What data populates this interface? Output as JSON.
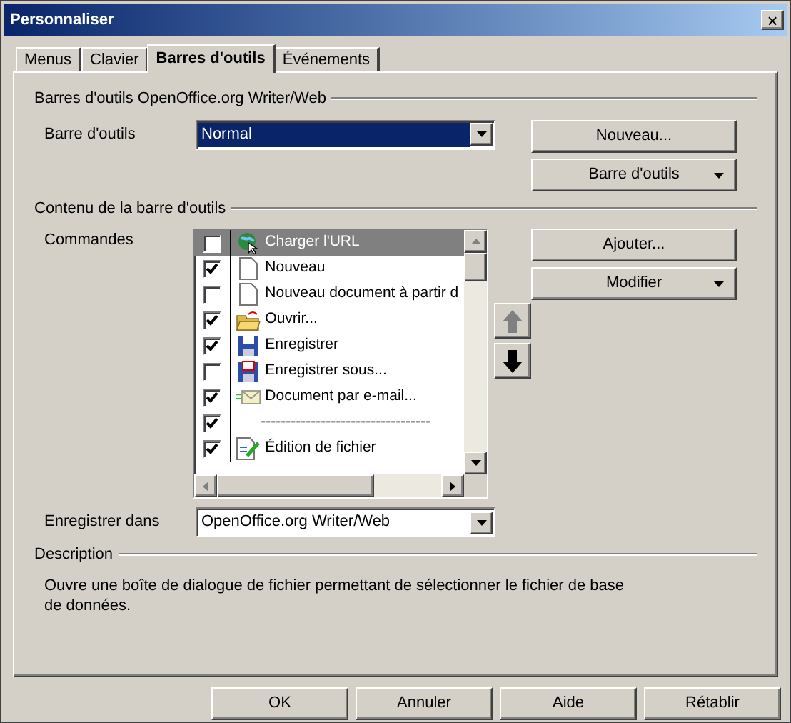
{
  "window": {
    "title": "Personnaliser",
    "close": "×"
  },
  "tabs": [
    {
      "label": "Menus",
      "selected": false
    },
    {
      "label": "Clavier",
      "selected": false
    },
    {
      "label": "Barres d'outils",
      "selected": true
    },
    {
      "label": "Événements",
      "selected": false
    }
  ],
  "toolbars_group": {
    "title": "Barres d'outils OpenOffice.org Writer/Web",
    "label": "Barre d'outils",
    "value": "Normal",
    "buttons": [
      "Nouveau...",
      "Barre d'outils"
    ]
  },
  "content_group": {
    "title": "Contenu de la barre d'outils",
    "label": "Commandes",
    "commands": [
      {
        "kind": "command",
        "label": "Charger l'URL",
        "checked": false,
        "selected": true
      },
      {
        "kind": "command",
        "label": "Nouveau",
        "checked": true,
        "selected": false
      },
      {
        "kind": "command",
        "label": "Nouveau document à partir d",
        "checked": false,
        "selected": false
      },
      {
        "kind": "command",
        "label": "Ouvrir...",
        "checked": true,
        "selected": false
      },
      {
        "kind": "command",
        "label": "Enregistrer",
        "checked": true,
        "selected": false
      },
      {
        "kind": "command",
        "label": "Enregistrer sous...",
        "checked": false,
        "selected": false
      },
      {
        "kind": "command",
        "label": "Document par e-mail...",
        "checked": true,
        "selected": false
      },
      {
        "kind": "separator",
        "label": "----------------------------------",
        "checked": true,
        "selected": false
      },
      {
        "kind": "command",
        "label": "Édition de fichier",
        "checked": true,
        "selected": false
      }
    ],
    "buttons": [
      "Ajouter...",
      "Modifier"
    ],
    "save_label": "Enregistrer dans",
    "save_value": "OpenOffice.org Writer/Web"
  },
  "description": {
    "title": "Description",
    "text": "Ouvre une boîte de dialogue de fichier permettant de sélectionner le fichier de base de données."
  },
  "footer_buttons": [
    "OK",
    "Annuler",
    "Aide",
    "Rétablir"
  ]
}
